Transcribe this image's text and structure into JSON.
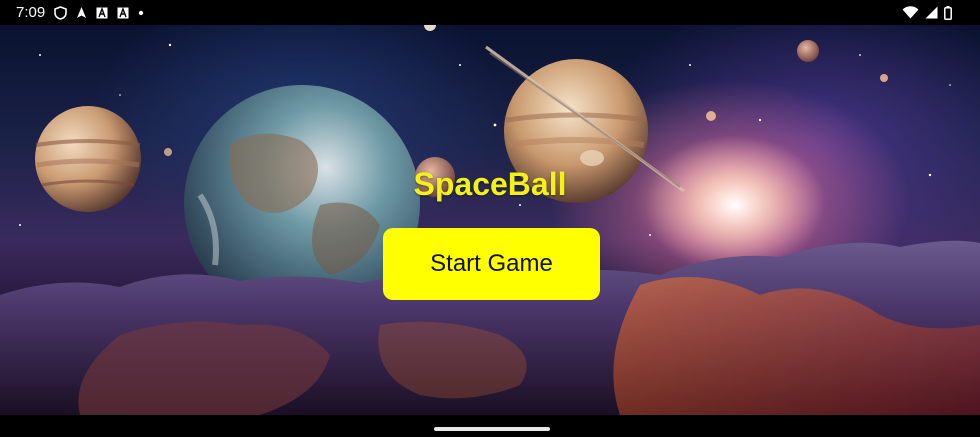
{
  "status_bar": {
    "time": "7:09",
    "icons_left": [
      "shield-icon",
      "navigation-arrow-icon",
      "text-a-icon",
      "text-a-icon",
      "dot-icon"
    ],
    "icons_right": [
      "wifi-icon",
      "signal-icon",
      "battery-icon"
    ]
  },
  "game": {
    "title": "SpaceBall",
    "start_button_label": "Start Game"
  },
  "colors": {
    "title": "#f2f215",
    "button_bg": "#ffff00",
    "button_text": "#111111"
  }
}
